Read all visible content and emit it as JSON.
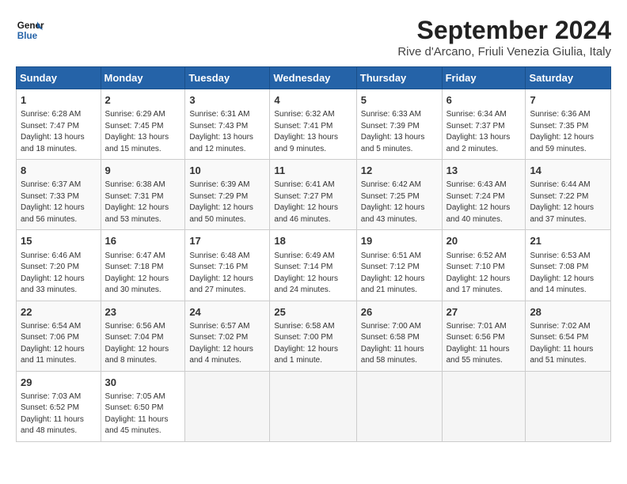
{
  "header": {
    "logo_line1": "General",
    "logo_line2": "Blue",
    "month_year": "September 2024",
    "location": "Rive d'Arcano, Friuli Venezia Giulia, Italy"
  },
  "weekdays": [
    "Sunday",
    "Monday",
    "Tuesday",
    "Wednesday",
    "Thursday",
    "Friday",
    "Saturday"
  ],
  "weeks": [
    [
      {
        "day": "1",
        "info": "Sunrise: 6:28 AM\nSunset: 7:47 PM\nDaylight: 13 hours\nand 18 minutes."
      },
      {
        "day": "2",
        "info": "Sunrise: 6:29 AM\nSunset: 7:45 PM\nDaylight: 13 hours\nand 15 minutes."
      },
      {
        "day": "3",
        "info": "Sunrise: 6:31 AM\nSunset: 7:43 PM\nDaylight: 13 hours\nand 12 minutes."
      },
      {
        "day": "4",
        "info": "Sunrise: 6:32 AM\nSunset: 7:41 PM\nDaylight: 13 hours\nand 9 minutes."
      },
      {
        "day": "5",
        "info": "Sunrise: 6:33 AM\nSunset: 7:39 PM\nDaylight: 13 hours\nand 5 minutes."
      },
      {
        "day": "6",
        "info": "Sunrise: 6:34 AM\nSunset: 7:37 PM\nDaylight: 13 hours\nand 2 minutes."
      },
      {
        "day": "7",
        "info": "Sunrise: 6:36 AM\nSunset: 7:35 PM\nDaylight: 12 hours\nand 59 minutes."
      }
    ],
    [
      {
        "day": "8",
        "info": "Sunrise: 6:37 AM\nSunset: 7:33 PM\nDaylight: 12 hours\nand 56 minutes."
      },
      {
        "day": "9",
        "info": "Sunrise: 6:38 AM\nSunset: 7:31 PM\nDaylight: 12 hours\nand 53 minutes."
      },
      {
        "day": "10",
        "info": "Sunrise: 6:39 AM\nSunset: 7:29 PM\nDaylight: 12 hours\nand 50 minutes."
      },
      {
        "day": "11",
        "info": "Sunrise: 6:41 AM\nSunset: 7:27 PM\nDaylight: 12 hours\nand 46 minutes."
      },
      {
        "day": "12",
        "info": "Sunrise: 6:42 AM\nSunset: 7:25 PM\nDaylight: 12 hours\nand 43 minutes."
      },
      {
        "day": "13",
        "info": "Sunrise: 6:43 AM\nSunset: 7:24 PM\nDaylight: 12 hours\nand 40 minutes."
      },
      {
        "day": "14",
        "info": "Sunrise: 6:44 AM\nSunset: 7:22 PM\nDaylight: 12 hours\nand 37 minutes."
      }
    ],
    [
      {
        "day": "15",
        "info": "Sunrise: 6:46 AM\nSunset: 7:20 PM\nDaylight: 12 hours\nand 33 minutes."
      },
      {
        "day": "16",
        "info": "Sunrise: 6:47 AM\nSunset: 7:18 PM\nDaylight: 12 hours\nand 30 minutes."
      },
      {
        "day": "17",
        "info": "Sunrise: 6:48 AM\nSunset: 7:16 PM\nDaylight: 12 hours\nand 27 minutes."
      },
      {
        "day": "18",
        "info": "Sunrise: 6:49 AM\nSunset: 7:14 PM\nDaylight: 12 hours\nand 24 minutes."
      },
      {
        "day": "19",
        "info": "Sunrise: 6:51 AM\nSunset: 7:12 PM\nDaylight: 12 hours\nand 21 minutes."
      },
      {
        "day": "20",
        "info": "Sunrise: 6:52 AM\nSunset: 7:10 PM\nDaylight: 12 hours\nand 17 minutes."
      },
      {
        "day": "21",
        "info": "Sunrise: 6:53 AM\nSunset: 7:08 PM\nDaylight: 12 hours\nand 14 minutes."
      }
    ],
    [
      {
        "day": "22",
        "info": "Sunrise: 6:54 AM\nSunset: 7:06 PM\nDaylight: 12 hours\nand 11 minutes."
      },
      {
        "day": "23",
        "info": "Sunrise: 6:56 AM\nSunset: 7:04 PM\nDaylight: 12 hours\nand 8 minutes."
      },
      {
        "day": "24",
        "info": "Sunrise: 6:57 AM\nSunset: 7:02 PM\nDaylight: 12 hours\nand 4 minutes."
      },
      {
        "day": "25",
        "info": "Sunrise: 6:58 AM\nSunset: 7:00 PM\nDaylight: 12 hours\nand 1 minute."
      },
      {
        "day": "26",
        "info": "Sunrise: 7:00 AM\nSunset: 6:58 PM\nDaylight: 11 hours\nand 58 minutes."
      },
      {
        "day": "27",
        "info": "Sunrise: 7:01 AM\nSunset: 6:56 PM\nDaylight: 11 hours\nand 55 minutes."
      },
      {
        "day": "28",
        "info": "Sunrise: 7:02 AM\nSunset: 6:54 PM\nDaylight: 11 hours\nand 51 minutes."
      }
    ],
    [
      {
        "day": "29",
        "info": "Sunrise: 7:03 AM\nSunset: 6:52 PM\nDaylight: 11 hours\nand 48 minutes."
      },
      {
        "day": "30",
        "info": "Sunrise: 7:05 AM\nSunset: 6:50 PM\nDaylight: 11 hours\nand 45 minutes."
      },
      {
        "day": "",
        "info": ""
      },
      {
        "day": "",
        "info": ""
      },
      {
        "day": "",
        "info": ""
      },
      {
        "day": "",
        "info": ""
      },
      {
        "day": "",
        "info": ""
      }
    ]
  ]
}
